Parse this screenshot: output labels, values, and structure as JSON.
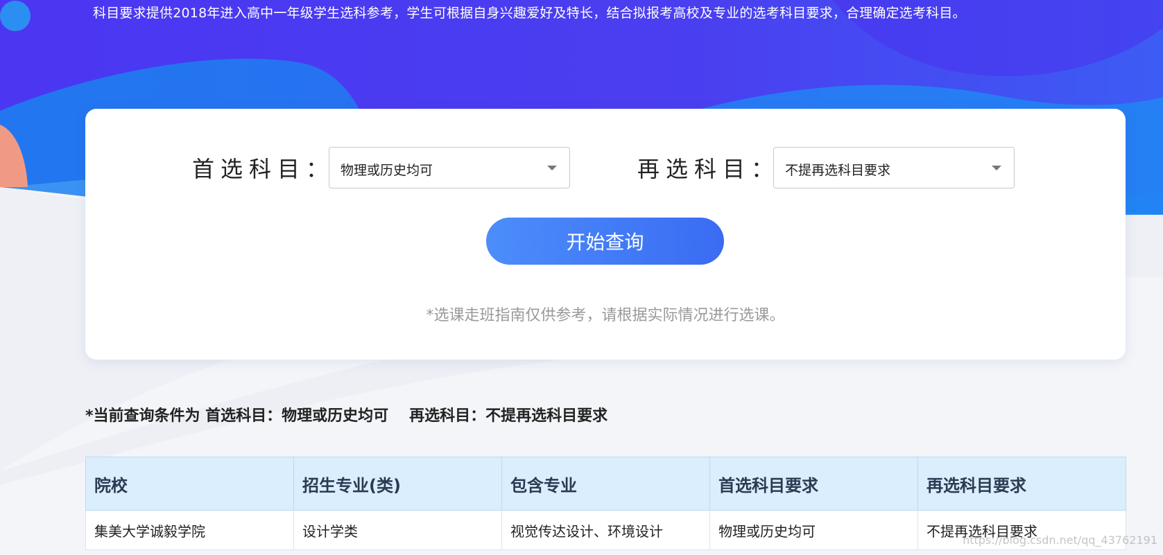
{
  "intro_text": "科目要求提供2018年进入高中一年级学生选科参考，学生可根据自身兴趣爱好及特长，结合拟报考高校及专业的选考科目要求，合理确定选考科目。",
  "form": {
    "primary_label": "首选科目：",
    "primary_value": "物理或历史均可",
    "secondary_label": "再选科目：",
    "secondary_value": "不提再选科目要求",
    "query_button": "开始查询",
    "disclaimer": "*选课走班指南仅供参考，请根据实际情况进行选课。"
  },
  "condition": {
    "prefix": "*当前查询条件为 首选科目：物理或历史均可",
    "secondary": "再选科目：不提再选科目要求"
  },
  "table": {
    "headers": [
      "院校",
      "招生专业(类)",
      "包含专业",
      "首选科目要求",
      "再选科目要求"
    ],
    "rows": [
      [
        "集美大学诚毅学院",
        "设计学类",
        "视觉传达设计、环境设计",
        "物理或历史均可",
        "不提再选科目要求"
      ]
    ]
  },
  "watermark": "https://blog.csdn.net/qq_43762191",
  "colors": {
    "banner_purple": "#4a2ef0",
    "banner_blue": "#1e8ef6",
    "button_blue": "#3a6cf3",
    "table_header_bg": "#daeefd"
  }
}
